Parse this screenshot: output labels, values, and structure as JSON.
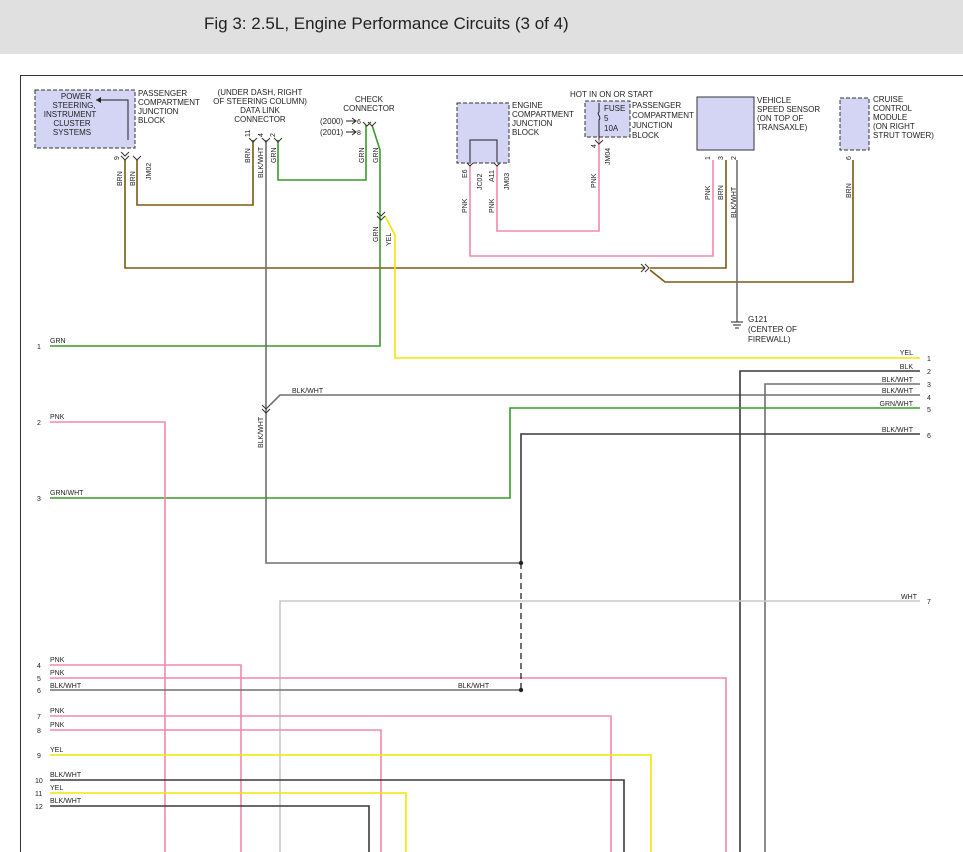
{
  "title": "Fig 3: 2.5L, Engine Performance Circuits (3 of 4)",
  "components": {
    "power_steering": [
      "POWER",
      "STEERING,",
      "INSTRUMENT",
      "CLUSTER",
      "SYSTEMS"
    ],
    "passenger_jb_1": [
      "PASSENGER",
      "COMPARTMENT",
      "JUNCTION",
      "BLOCK"
    ],
    "data_link": [
      "(UNDER DASH, RIGHT",
      "OF STEERING COLUMN)",
      "DATA LINK",
      "CONNECTOR"
    ],
    "check_connector": [
      "CHECK",
      "CONNECTOR"
    ],
    "check_years": [
      "(2000)",
      "(2001)"
    ],
    "engine_jb": [
      "ENGINE",
      "COMPARTMENT",
      "JUNCTION",
      "BLOCK"
    ],
    "hot_in": "HOT IN ON OR START",
    "fuse": [
      "FUSE",
      "5",
      "10A"
    ],
    "passenger_jb_2": [
      "PASSENGER",
      "COMPARTMENT",
      "JUNCTION",
      "BLOCK"
    ],
    "vss": [
      "VEHICLE",
      "SPEED SENSOR",
      "(ON TOP OF",
      "TRANSAXLE)"
    ],
    "cruise": [
      "CRUISE",
      "CONTROL",
      "MODULE",
      "(ON RIGHT",
      "STRUT TOWER)"
    ],
    "ground": [
      "G121",
      "(CENTER OF",
      "FIREWALL)"
    ]
  },
  "pins": {
    "ps_9": "9",
    "dlc_11": "11",
    "dlc_4": "4",
    "dlc_2": "2",
    "chk_6": "6",
    "chk_8": "8",
    "ejb_e6": "E6",
    "ejb_a11": "A11",
    "pjb_4": "4",
    "vss_1": "1",
    "vss_3": "3",
    "vss_2": "2",
    "ccm_6": "6"
  },
  "connectors": {
    "jm02": "JM02",
    "jc02": "JC02",
    "jm03": "JM03",
    "jm04": "JM04"
  },
  "wire_labels": {
    "brn": "BRN",
    "grn": "GRN",
    "yel": "YEL",
    "pnk": "PNK",
    "blk_wht": "BLK/WHT",
    "grn_wht": "GRN/WHT",
    "blk": "BLK",
    "wht": "WHT"
  },
  "left_pins": [
    {
      "num": "1",
      "color": "GRN"
    },
    {
      "num": "2",
      "color": "PNK"
    },
    {
      "num": "3",
      "color": "GRN/WHT"
    },
    {
      "num": "4",
      "color": "PNK"
    },
    {
      "num": "5",
      "color": "PNK"
    },
    {
      "num": "6",
      "color": "BLK/WHT"
    },
    {
      "num": "7",
      "color": "PNK"
    },
    {
      "num": "8",
      "color": "PNK"
    },
    {
      "num": "9",
      "color": "YEL"
    },
    {
      "num": "10",
      "color": "BLK/WHT"
    },
    {
      "num": "11",
      "color": "YEL"
    },
    {
      "num": "12",
      "color": "BLK/WHT"
    }
  ],
  "right_pins": [
    {
      "num": "1",
      "color": "YEL"
    },
    {
      "num": "2",
      "color": "BLK"
    },
    {
      "num": "3",
      "color": "BLK/WHT"
    },
    {
      "num": "4",
      "color": "BLK/WHT"
    },
    {
      "num": "5",
      "color": "GRN/WHT"
    },
    {
      "num": "6",
      "color": "BLK/WHT"
    },
    {
      "num": "7",
      "color": "WHT"
    }
  ],
  "wire_colors": {
    "brn": "#7a5a14",
    "grn": "#3a9a2a",
    "yel": "#f2e600",
    "pnk": "#f08aa8",
    "gray": "#707070",
    "dark": "#3a3a3a",
    "wht": "#c8c8c8",
    "box_fill": "#d4d4f4"
  }
}
